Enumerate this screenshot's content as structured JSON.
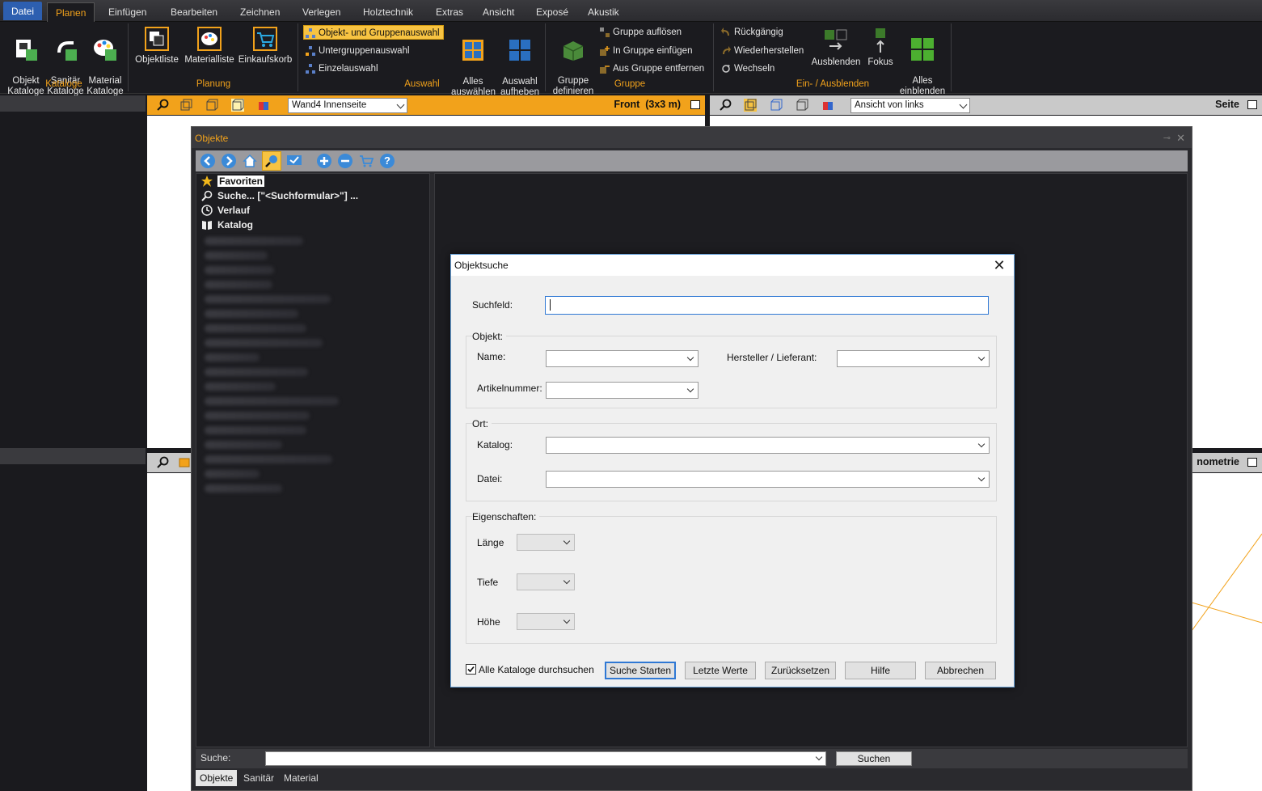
{
  "menu": {
    "tabs": [
      "Datei",
      "Planen",
      "Einfügen",
      "Bearbeiten",
      "Zeichnen",
      "Verlegen",
      "Holztechnik",
      "Extras",
      "Ansicht",
      "Exposé",
      "Akustik"
    ]
  },
  "ribbon": {
    "kataloge": {
      "objekt": "Objekt\nKataloge",
      "sanitaer": "Sanitär\nKataloge",
      "material": "Material\nKataloge",
      "label": "Kataloge"
    },
    "planung": {
      "objektliste": "Objektliste",
      "materialliste": "Materialliste",
      "einkaufskorb": "Einkaufskorb",
      "label": "Planung"
    },
    "auswahl": {
      "objekt_gruppen": "Objekt- und Gruppenauswahl",
      "untergruppen": "Untergruppenauswahl",
      "einzel": "Einzelauswahl",
      "alles": "Alles\nauswählen",
      "aufheben": "Auswahl\naufheben",
      "label": "Auswahl"
    },
    "gruppe": {
      "definieren": "Gruppe\ndefinieren",
      "aufloesen": "Gruppe auflösen",
      "einfuegen": "In Gruppe einfügen",
      "entfernen": "Aus Gruppe entfernen",
      "label": "Gruppe"
    },
    "einaus": {
      "rueckgaengig": "Rückgängig",
      "wiederherstellen": "Wiederherstellen",
      "wechseln": "Wechseln",
      "ausblenden": "Ausblenden",
      "fokus": "Fokus",
      "alles": "Alles\neinblenden",
      "label": "Ein- / Ausblenden"
    }
  },
  "viewports": {
    "front_select": "Wand4 Innenseite",
    "front_title": "Front  (3x3 m)",
    "side_select": "Ansicht von links",
    "side_title": "Seite",
    "iso_title": "nometrie"
  },
  "objekte": {
    "title": "Objekte",
    "tree": {
      "favoriten": "Favoriten",
      "suche": "Suche... [\"<Suchformular>\"] ...",
      "verlauf": "Verlauf",
      "katalog": "Katalog"
    },
    "search_label": "Suche:",
    "search_button": "Suchen",
    "tabs": [
      "Objekte",
      "Sanitär",
      "Material"
    ]
  },
  "dialog": {
    "title": "Objektsuche",
    "suchfeld_label": "Suchfeld:",
    "suchfeld_value": "",
    "objekt_group": "Objekt:",
    "name_label": "Name:",
    "hersteller_label": "Hersteller / Lieferant:",
    "artikel_label": "Artikelnummer:",
    "ort_group": "Ort:",
    "katalog_label": "Katalog:",
    "datei_label": "Datei:",
    "eigenschaften_group": "Eigenschaften:",
    "laenge_label": "Länge",
    "tiefe_label": "Tiefe",
    "hoehe_label": "Höhe",
    "alle_kataloge": "Alle Kataloge durchsuchen",
    "alle_kataloge_checked": true,
    "buttons": {
      "start": "Suche Starten",
      "letzte": "Letzte Werte",
      "reset": "Zurücksetzen",
      "hilfe": "Hilfe",
      "abbrechen": "Abbrechen"
    }
  },
  "colors": {
    "accent": "#f2a21b",
    "file_tab": "#2d5fb0",
    "dialog_focus": "#2f78d4"
  }
}
